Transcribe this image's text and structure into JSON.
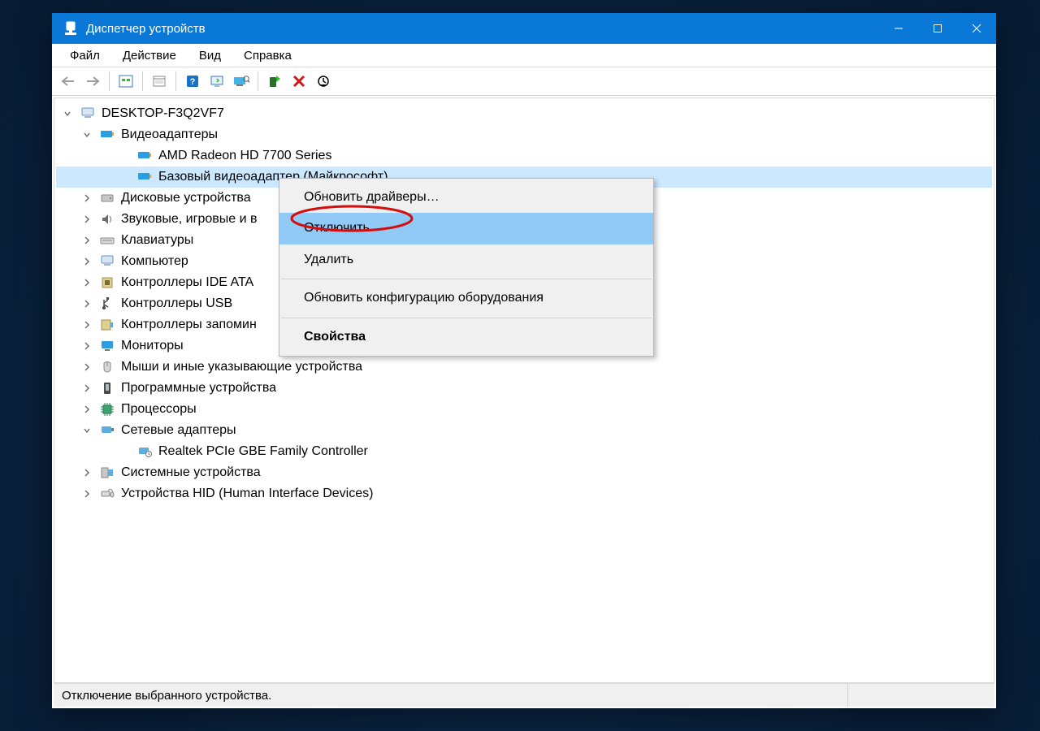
{
  "titlebar": {
    "title": "Диспетчер устройств"
  },
  "menu": {
    "file": "Файл",
    "action": "Действие",
    "view": "Вид",
    "help": "Справка"
  },
  "statusbar": {
    "text": "Отключение выбранного устройства."
  },
  "tree": {
    "root": "DESKTOP-F3Q2VF7",
    "display_adapters": "Видеоадаптеры",
    "display_adapter_1": "AMD Radeon HD 7700 Series",
    "display_adapter_2": "Базовый видеоадаптер (Майкрософт)",
    "disk_drives": "Дисковые устройства",
    "sound": "Звуковые, игровые и в",
    "keyboards": "Клавиатуры",
    "computer": "Компьютер",
    "ide": "Контроллеры IDE ATA",
    "usb": "Контроллеры USB",
    "storage_ctl": "Контроллеры запомин",
    "monitors": "Мониторы",
    "mouse": "Мыши и иные указывающие устройства",
    "software_dev": "Программные устройства",
    "processors": "Процессоры",
    "network_adapters": "Сетевые адаптеры",
    "network_adapter_1": "Realtek PCIe GBE Family Controller",
    "system_dev": "Системные устройства",
    "hid": "Устройства HID (Human Interface Devices)"
  },
  "context_menu": {
    "update_drivers": "Обновить драйверы…",
    "disable": "Отключить",
    "uninstall": "Удалить",
    "scan_hardware": "Обновить конфигурацию оборудования",
    "properties": "Свойства"
  },
  "context_menu_highlighted": "disable",
  "context_menu_default": "properties"
}
